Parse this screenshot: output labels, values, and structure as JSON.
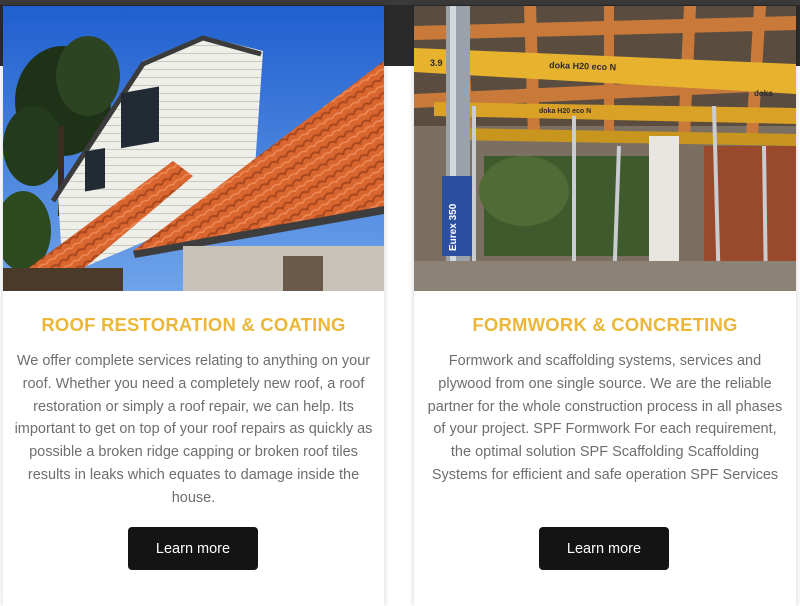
{
  "cards": [
    {
      "title": "ROOF RESTORATION & COATING",
      "text": "We offer complete services relating to anything on your roof. Whether you need a completely new roof, a roof restoration or simply a roof repair, we can help. Its important to get on top of your roof repairs as quickly as possible a broken ridge capping or broken roof tiles results in leaks which equates to damage inside the house.",
      "button_label": "Learn more",
      "image_alt": "Terracotta tiled roof on a white weatherboard house"
    },
    {
      "title": "FORMWORK & CONCRETING",
      "text": "Formwork and scaffolding systems, services and plywood from one single source. We are the reliable partner for the whole construction process in all phases of your project. SPF Formwork For each requirement, the optimal solution SPF Scaffolding Scaffolding Systems for efficient and safe operation SPF Services",
      "button_label": "Learn more",
      "image_alt": "Formwork beams and steel props under a concrete slab",
      "beam_labels": [
        "doka H20 eco N",
        "doka H20 eco N",
        "doka",
        "3.9",
        "Eurex 350"
      ]
    }
  ],
  "colors": {
    "heading": "#ebb73a",
    "body_text": "#6e6e6e",
    "button_bg": "#141414",
    "button_text": "#ffffff",
    "top_band": "#2b2b2b"
  }
}
